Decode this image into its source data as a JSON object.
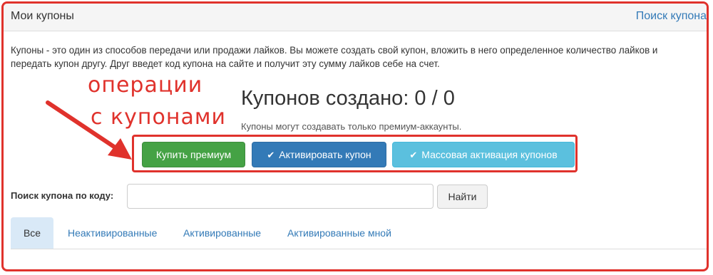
{
  "header": {
    "title": "Мои купоны",
    "search_link": "Поиск купона"
  },
  "intro": {
    "text": "Купоны - это один из способов передачи или продажи лайков. Вы можете создать свой купон, вложить в него определенное количество лайков и передать купон другу. Друг введет код купона на сайте и получит эту сумму лайков себе на счет."
  },
  "annotation": {
    "line1": "операции",
    "line2": "с купонами",
    "color": "#e0322c"
  },
  "coupons": {
    "title": "Купонов создано: 0 / 0",
    "subtitle": "Купоны могут создавать только премиум-аккаунты."
  },
  "actions": {
    "buy_premium": "Купить премиум",
    "activate": "Активировать купон",
    "mass_activate": "Массовая активация купонов",
    "check_icon": "✔"
  },
  "search": {
    "label": "Поиск купона по коду:",
    "value": "",
    "placeholder": "",
    "button": "Найти"
  },
  "tabs": [
    {
      "label": "Все",
      "active": true
    },
    {
      "label": "Неактивированные",
      "active": false
    },
    {
      "label": "Активированные",
      "active": false
    },
    {
      "label": "Активированные мной",
      "active": false
    }
  ],
  "colors": {
    "success": "#45a245",
    "primary": "#337ab7",
    "info": "#5bc0de",
    "link": "#337ab7",
    "highlight": "#e0322c"
  }
}
